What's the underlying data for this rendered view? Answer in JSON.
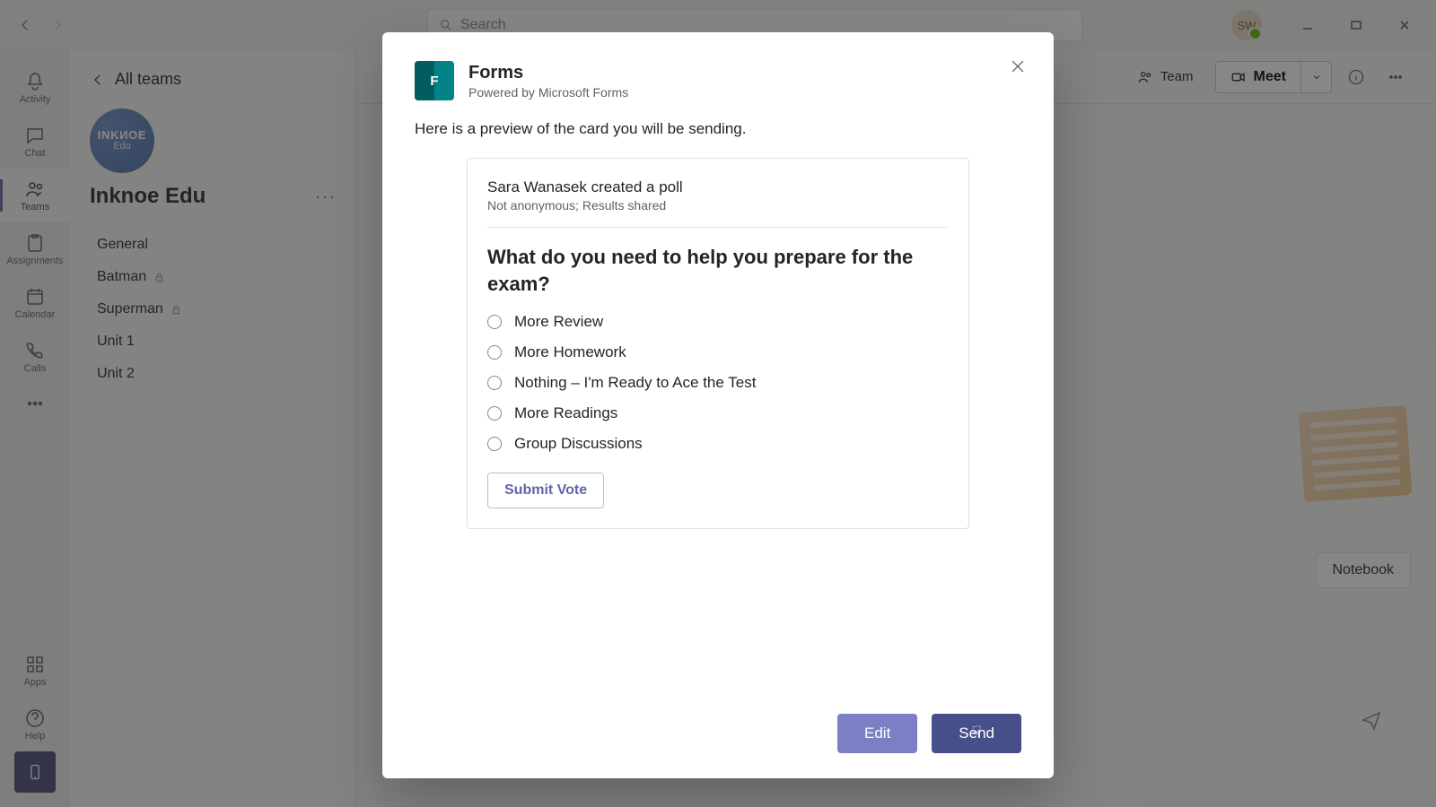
{
  "titlebar": {
    "search_placeholder": "Search",
    "avatar_initials": "SW"
  },
  "rail": {
    "activity": "Activity",
    "chat": "Chat",
    "teams": "Teams",
    "assignments": "Assignments",
    "calendar": "Calendar",
    "calls": "Calls",
    "apps": "Apps",
    "help": "Help"
  },
  "sidebar": {
    "all_teams": "All teams",
    "team_avatar_top": "INKИOE",
    "team_avatar_bottom": "Edu",
    "team_name": "Inknoe Edu",
    "channels": [
      {
        "label": "General",
        "private": false
      },
      {
        "label": "Batman",
        "private": true
      },
      {
        "label": "Superman",
        "private": true
      },
      {
        "label": "Unit 1",
        "private": false
      },
      {
        "label": "Unit 2",
        "private": false
      }
    ]
  },
  "header": {
    "team_btn": "Team",
    "meet_btn": "Meet"
  },
  "main": {
    "notebook_label": "Notebook"
  },
  "modal": {
    "title": "Forms",
    "subtitle": "Powered by Microsoft Forms",
    "intro": "Here is a preview of the card you will be sending.",
    "card": {
      "creator_line": "Sara Wanasek created a poll",
      "meta": "Not anonymous; Results shared",
      "question": "What do you need to help you prepare for the exam?",
      "options": [
        "More Review",
        "More Homework",
        "Nothing – I'm Ready to Ace the Test",
        "More Readings",
        "Group Discussions"
      ],
      "submit_label": "Submit Vote"
    },
    "edit_label": "Edit",
    "send_label": "Send"
  }
}
